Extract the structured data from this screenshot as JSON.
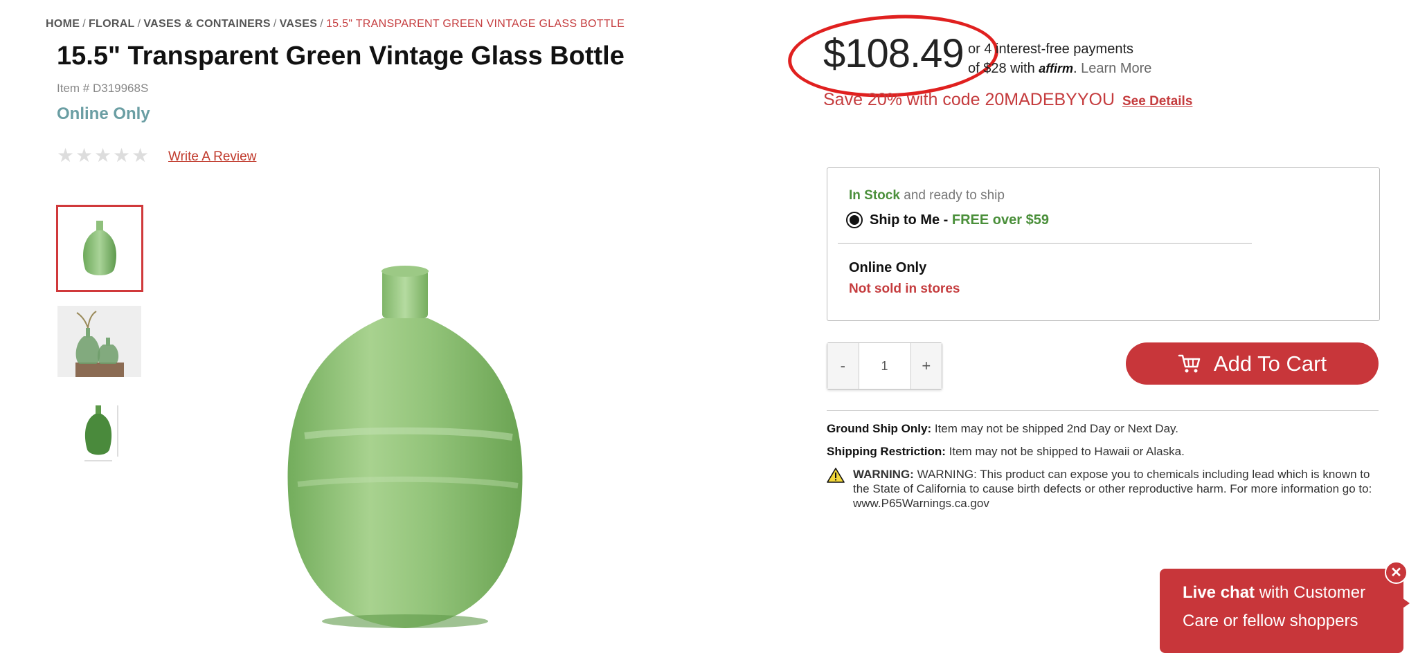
{
  "breadcrumb": {
    "items": [
      "HOME",
      "FLORAL",
      "VASES & CONTAINERS",
      "VASES"
    ],
    "current": "15.5\" TRANSPARENT GREEN VINTAGE GLASS BOTTLE"
  },
  "product": {
    "title": "15.5\" Transparent Green Vintage Glass Bottle",
    "item_number": "Item # D319968S",
    "availability_tag": "Online Only",
    "rating": 0,
    "rating_max": 5,
    "write_review": "Write A Review"
  },
  "pricing": {
    "price": "$108.49",
    "affirm_line1": "or 4 interest-free payments",
    "affirm_line2_prefix": "of $28 with",
    "affirm_logo": "affirm",
    "learn_more": "Learn More",
    "promo": "Save 20% with code 20MADEBYYOU",
    "see_details": "See Details"
  },
  "shipping": {
    "stock_status": "In Stock",
    "stock_suffix": "and ready to ship",
    "option_label": "Ship to Me -",
    "option_free": "FREE over $59",
    "online_only": "Online Only",
    "not_sold": "Not sold in stores"
  },
  "cart": {
    "minus": "-",
    "quantity": "1",
    "plus": "+",
    "add_to_cart": "Add To Cart"
  },
  "notes": {
    "ground_label": "Ground Ship Only:",
    "ground_text": "Item may not be shipped 2nd Day or Next Day.",
    "restriction_label": "Shipping Restriction:",
    "restriction_text": "Item may not be shipped to Hawaii or Alaska.",
    "warning_label": "WARNING:",
    "warning_text": "WARNING: This product can expose you to chemicals including lead which is known to the State of California to cause birth defects or other reproductive harm. For more information go to: www.P65Warnings.ca.gov"
  },
  "chat": {
    "bold": "Live chat",
    "rest": "with Customer Care or fellow shoppers",
    "close": "✕"
  },
  "colors": {
    "brand_red": "#c8363a",
    "stock_green": "#4a8f3a",
    "online_teal": "#6a9ea3",
    "annotation_ring": "#e0201f"
  },
  "icons": [
    "cart-icon",
    "warning-icon",
    "close-icon",
    "star-icon"
  ]
}
